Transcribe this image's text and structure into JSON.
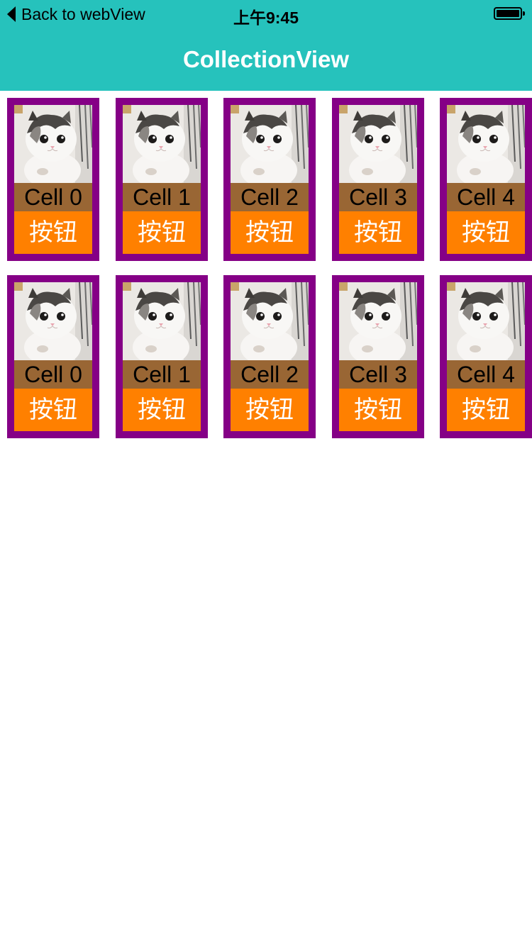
{
  "status_bar": {
    "back_label": "Back to webView",
    "time": "上午9:45",
    "battery_level": 1.0
  },
  "nav": {
    "title": "CollectionView",
    "background": "#26c2bc"
  },
  "colors": {
    "cell_border": "#850086",
    "label_bg": "#996634",
    "button_bg": "#ff8000"
  },
  "rows": [
    {
      "cells": [
        {
          "label": "Cell 0",
          "button": "按钮",
          "image": "cat-photo"
        },
        {
          "label": "Cell 1",
          "button": "按钮",
          "image": "cat-photo"
        },
        {
          "label": "Cell 2",
          "button": "按钮",
          "image": "cat-photo"
        },
        {
          "label": "Cell 3",
          "button": "按钮",
          "image": "cat-photo"
        },
        {
          "label": "Cell 4",
          "button": "按钮",
          "image": "cat-photo"
        }
      ]
    },
    {
      "cells": [
        {
          "label": "Cell 0",
          "button": "按钮",
          "image": "cat-photo"
        },
        {
          "label": "Cell 1",
          "button": "按钮",
          "image": "cat-photo"
        },
        {
          "label": "Cell 2",
          "button": "按钮",
          "image": "cat-photo"
        },
        {
          "label": "Cell 3",
          "button": "按钮",
          "image": "cat-photo"
        },
        {
          "label": "Cell 4",
          "button": "按钮",
          "image": "cat-photo"
        }
      ]
    }
  ]
}
